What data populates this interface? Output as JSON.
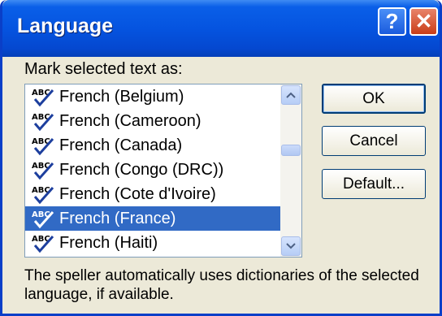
{
  "window": {
    "title": "Language",
    "help_label": "?",
    "close_label": "✕"
  },
  "list": {
    "label": "Mark selected text as:",
    "items": [
      {
        "label": "French (Belgium)",
        "selected": false
      },
      {
        "label": "French (Cameroon)",
        "selected": false
      },
      {
        "label": "French (Canada)",
        "selected": false
      },
      {
        "label": "French (Congo (DRC))",
        "selected": false
      },
      {
        "label": "French (Cote d'Ivoire)",
        "selected": false
      },
      {
        "label": "French (France)",
        "selected": true
      },
      {
        "label": "French (Haiti)",
        "selected": false
      }
    ]
  },
  "buttons": {
    "ok": "OK",
    "cancel": "Cancel",
    "default": "Default..."
  },
  "footnote": "The speller automatically uses dictionaries of the selected language, if available.",
  "colors": {
    "titlebar": "#0554e0",
    "selection": "#316ac5",
    "dialog_bg": "#ece9d8"
  },
  "icons": {
    "item_icon": "spellcheck-icon",
    "scroll_up": "scroll-up-arrow-icon",
    "scroll_down": "scroll-down-arrow-icon"
  }
}
